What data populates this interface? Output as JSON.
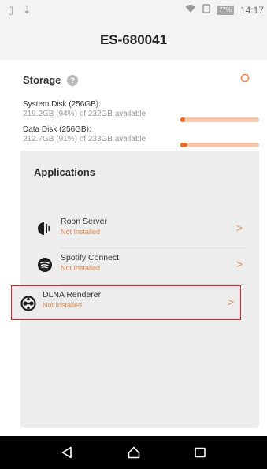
{
  "status_bar": {
    "time": "14:17",
    "battery": "77%",
    "icons": [
      "sim-card-icon",
      "download-icon",
      "wifi-icon",
      "signal-icon",
      "battery-icon"
    ]
  },
  "header": {
    "title": "ES-680041"
  },
  "storage": {
    "heading": "Storage",
    "disks": [
      {
        "name": "System Disk (256GB):",
        "usage": "219.2GB (94%) of 232GB available",
        "used_fraction": 0.06
      },
      {
        "name": "Data Disk (256GB):",
        "usage": "212.7GB (91%) of 233GB available",
        "used_fraction": 0.09
      }
    ]
  },
  "applications": {
    "heading": "Applications",
    "items": [
      {
        "name": "Roon Server",
        "status": "Not Installed",
        "icon": "roon-icon"
      },
      {
        "name": "Spotify Connect",
        "status": "Not Installed",
        "icon": "spotify-icon"
      },
      {
        "name": "DLNA Renderer",
        "status": "Not Installed",
        "icon": "dlna-icon",
        "selected": true
      }
    ]
  },
  "nav": {
    "buttons": [
      "back-icon",
      "home-icon",
      "recents-icon"
    ]
  },
  "colors": {
    "accent": "#e56a24",
    "highlight_border": "#e0202e",
    "nav_bg": "#000000"
  }
}
